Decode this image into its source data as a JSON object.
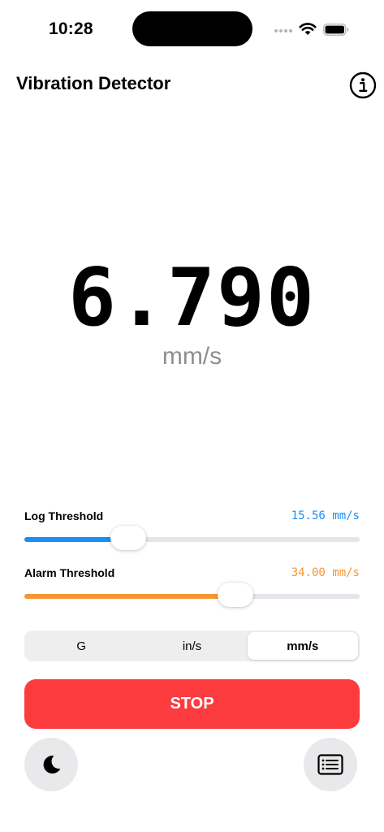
{
  "status_bar": {
    "time": "10:28",
    "icons": [
      "cellular-dots-icon",
      "wifi-icon",
      "battery-icon"
    ]
  },
  "header": {
    "title": "Vibration Detector",
    "info_icon": "info-circle-icon"
  },
  "reading": {
    "value": "6.790",
    "unit": "mm/s"
  },
  "log_threshold": {
    "label": "Log Threshold",
    "value_text": "15.56 mm/s",
    "fraction": 0.31,
    "color": "#1a8ff5"
  },
  "alarm_threshold": {
    "label": "Alarm Threshold",
    "value_text": "34.00 mm/s",
    "fraction": 0.63,
    "color": "#f79433"
  },
  "units": {
    "options": [
      "G",
      "in/s",
      "mm/s"
    ],
    "selected": "mm/s"
  },
  "stop_button": {
    "label": "STOP",
    "color": "#fc3b3f"
  },
  "bottom": {
    "left_icon": "moon-icon",
    "right_icon": "log-list-icon"
  }
}
